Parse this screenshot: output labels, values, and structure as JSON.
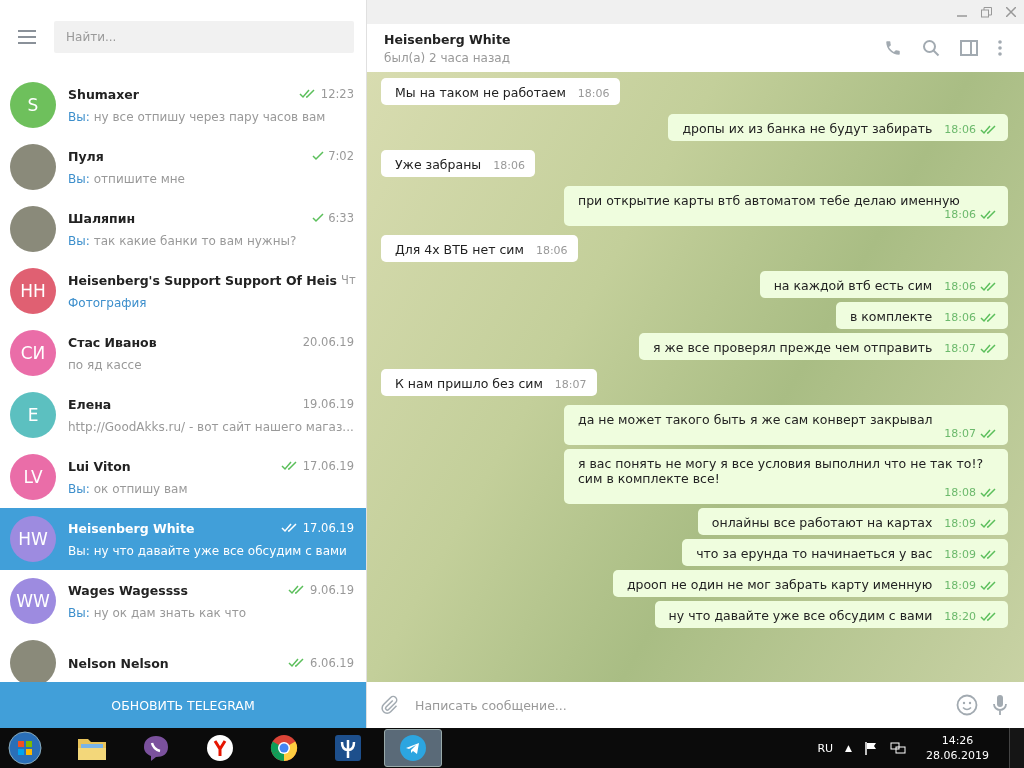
{
  "search": {
    "placeholder": "Найти..."
  },
  "chats": [
    {
      "avatar": {
        "kind": "initials",
        "initials": "S",
        "color": "#6ec05c"
      },
      "name": "Shumaxer",
      "time": "12:23",
      "sent": true,
      "read": true,
      "you": "Вы:",
      "preview": "ну все отпишу через пару часов вам",
      "media": false,
      "selected": false
    },
    {
      "avatar": {
        "kind": "photo"
      },
      "name": "Пуля",
      "time": "7:02",
      "sent": true,
      "read": false,
      "you": "Вы:",
      "preview": "отпишите мне",
      "media": false,
      "selected": false
    },
    {
      "avatar": {
        "kind": "photo"
      },
      "name": "Шаляпин",
      "time": "6:33",
      "sent": true,
      "read": false,
      "you": "Вы:",
      "preview": "так какие банки то вам нужны?",
      "media": false,
      "selected": false
    },
    {
      "avatar": {
        "kind": "initials",
        "initials": "HH",
        "color": "#e06072"
      },
      "name": "Heisenberg's Support Support Of Heis",
      "time": "Чт",
      "preview": "Фотография",
      "media": true,
      "selected": false
    },
    {
      "avatar": {
        "kind": "initials",
        "initials": "СИ",
        "color": "#ea6da8"
      },
      "name": "Стас Иванов",
      "time": "20.06.19",
      "preview": "по яд кассе",
      "media": false,
      "selected": false
    },
    {
      "avatar": {
        "kind": "initials",
        "initials": "Е",
        "color": "#5cc0c0"
      },
      "name": "Елена",
      "time": "19.06.19",
      "preview": "http://GoodAkks.ru/ - вот сайт нашего магаз...",
      "media": false,
      "selected": false
    },
    {
      "avatar": {
        "kind": "initials",
        "initials": "LV",
        "color": "#ea6da8"
      },
      "name": "Lui Viton",
      "time": "17.06.19",
      "sent": true,
      "read": true,
      "you": "Вы:",
      "preview": "ок отпишу вам",
      "media": false,
      "selected": false
    },
    {
      "avatar": {
        "kind": "initials",
        "initials": "HW",
        "color": "#9d8be0"
      },
      "name": "Heisenberg White",
      "time": "17.06.19",
      "sent": true,
      "read": true,
      "you": "Вы:",
      "preview": "ну что давайте уже все обсудим с вами",
      "media": false,
      "selected": true
    },
    {
      "avatar": {
        "kind": "initials",
        "initials": "WW",
        "color": "#9d8be0"
      },
      "name": "Wages Wagessss",
      "time": "9.06.19",
      "sent": true,
      "read": true,
      "you": "Вы:",
      "preview": "ну ок дам знать как что",
      "media": false,
      "selected": false
    },
    {
      "avatar": {
        "kind": "photo"
      },
      "name": "Nelson Nelson",
      "time": "6.06.19",
      "sent": true,
      "read": true,
      "selected": false
    }
  ],
  "update_button": "ОБНОВИТЬ TELEGRAM",
  "chat": {
    "name": "Heisenberg White",
    "last_seen": "был(а) 2 часа назад"
  },
  "messages": [
    {
      "kind": "in",
      "text": "Мы на таком не работаем",
      "time": "18:06"
    },
    {
      "kind": "out",
      "text": "дропы их из банка не будут забирать",
      "time": "18:06",
      "read": true
    },
    {
      "kind": "in",
      "text": "Уже  забраны",
      "time": "18:06"
    },
    {
      "kind": "out",
      "text": "при открытие карты втб автоматом тебе делаю именную",
      "time": "18:06",
      "read": true
    },
    {
      "kind": "in",
      "text": "Для 4х ВТБ нет сим",
      "time": "18:06"
    },
    {
      "kind": "out",
      "text": "на каждой втб есть сим",
      "time": "18:06",
      "read": true
    },
    {
      "kind": "out",
      "text": "в комплекте",
      "time": "18:06",
      "read": true
    },
    {
      "kind": "out",
      "text": "я же все проверял прежде чем отправить",
      "time": "18:07",
      "read": true
    },
    {
      "kind": "in",
      "text": "К нам пришло без сим",
      "time": "18:07"
    },
    {
      "kind": "out",
      "text": "да не может такого быть я же сам конверт закрывал",
      "time": "18:07",
      "read": true
    },
    {
      "kind": "out",
      "text": "я вас понять не могу я все условия выполнил что не так то!? сим в комплекте все!",
      "time": "18:08",
      "read": true
    },
    {
      "kind": "out",
      "text": "онлайны все работают на картах",
      "time": "18:09",
      "read": true
    },
    {
      "kind": "out",
      "text": "что за ерунда то начинаеться у вас",
      "time": "18:09",
      "read": true
    },
    {
      "kind": "out",
      "text": "дрооп не один не мог забрать карту именную",
      "time": "18:09",
      "read": true
    },
    {
      "kind": "out",
      "text": "ну что давайте уже все обсудим с вами",
      "time": "18:20",
      "read": true
    }
  ],
  "composer": {
    "placeholder": "Написать сообщение..."
  },
  "taskbar": {
    "apps": [
      {
        "kind": "folder",
        "selected": false
      },
      {
        "kind": "viber",
        "selected": false
      },
      {
        "kind": "yandex",
        "selected": false
      },
      {
        "kind": "chrome",
        "selected": false
      },
      {
        "kind": "psi",
        "selected": false
      },
      {
        "kind": "telegram",
        "selected": true
      }
    ],
    "language": "RU",
    "tray_arrow": "▲",
    "time": "14:26",
    "date": "28.06.2019"
  }
}
